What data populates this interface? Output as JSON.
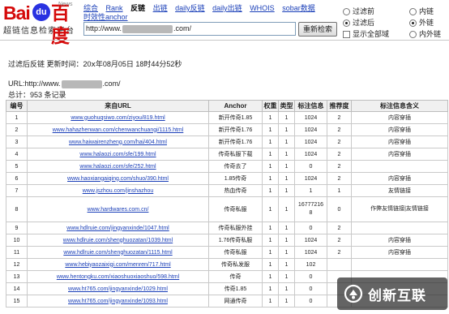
{
  "header": {
    "logo_left": "Bai",
    "logo_paw": "du",
    "logo_right": "百度",
    "logo_tag": "News",
    "logo_subtitle": "超链信息检索平台",
    "nav": [
      "综合",
      "Rank",
      "反链",
      "出链",
      "daily反链",
      "daily出链",
      "WHOIS",
      "sobar数据"
    ],
    "nav_active_index": 2,
    "nav_second": "时效性anchor",
    "url_prefix": "http://www.",
    "url_suffix": ".com/",
    "search_button": "重新检索",
    "option_left": [
      "过滤前",
      "过滤后",
      "显示全部域"
    ],
    "option_right": [
      "内链",
      "外链",
      "内外链"
    ]
  },
  "info": {
    "line1": "过滤后反链  更新时间：20ⅹ年08月05日  18时44分52秒",
    "url_label": "URL:http://www.",
    "url_suffix": ".com/",
    "total": "总计：953 条记录"
  },
  "table": {
    "headers": [
      "编号",
      "来自URL",
      "Anchor",
      "权重",
      "类型",
      "标注信息",
      "推荐度",
      "标注信息含义"
    ],
    "rows": [
      [
        "1",
        "www.guohuqsiwo.com/ziyou/819.html",
        "新开传奇1.85",
        "1",
        "1",
        "1024",
        "2",
        "内容穿插"
      ],
      [
        "2",
        "www.hahazhenwan.com/chenwanchuangi/1115.html",
        "新开传奇1.76",
        "1",
        "1",
        "1024",
        "2",
        "内容穿插"
      ],
      [
        "3",
        "www.haiwairenzheng.com/hai/404.html",
        "新开传奇1.76",
        "1",
        "1",
        "1024",
        "2",
        "内容穿插"
      ],
      [
        "4",
        "www.halaozi.com/sfe/199.html",
        "传奇私服下载",
        "1",
        "1",
        "1024",
        "2",
        "内容穿插"
      ],
      [
        "5",
        "www.halaozi.com/sfe/252.html",
        "传奇去了",
        "1",
        "1",
        "0",
        "2",
        ""
      ],
      [
        "6",
        "www.haoxiangaiqing.com/shuo/390.html",
        "1.85传奇",
        "1",
        "1",
        "1024",
        "2",
        "内容穿插"
      ],
      [
        "7",
        "www.jszhou.com/jinshazhou",
        "热血传奇",
        "1",
        "1",
        "1",
        "1",
        "友情链接"
      ],
      [
        "8",
        "www.hardwares.com.cn/",
        "传奇私服",
        "1",
        "1",
        "16777216\n8",
        "0",
        "作弊友情链接|友情链接"
      ],
      [
        "9",
        "www.hdlruie.com/jingyanxinde/1047.html",
        "传奇私服外挂",
        "1",
        "1",
        "0",
        "2",
        ""
      ],
      [
        "10",
        "www.hdlruie.com/shenghuozatan/1039.html",
        "1.76传奇私服",
        "1",
        "1",
        "1024",
        "2",
        "内容穿插"
      ],
      [
        "11",
        "www.hdlruie.com/shenghuozatan/1115.html",
        "传奇私服",
        "1",
        "1",
        "1024",
        "2",
        "内容穿插"
      ],
      [
        "12",
        "www.hebiyaozaixigi.com/menren/717.html",
        "传奇私发服",
        "1",
        "1",
        "102",
        "",
        ""
      ],
      [
        "13",
        "www.hentongku.com/xiaoshuoxiaoshuo/598.html",
        "传奇",
        "1",
        "1",
        "0",
        "",
        ""
      ],
      [
        "14",
        "www.ht765.com/jingyanxinde/1029.html",
        "传奇1.85",
        "1",
        "1",
        "0",
        "",
        ""
      ],
      [
        "15",
        "www.ht765.com/jingyanxinde/1093.html",
        "网通传奇",
        "1",
        "1",
        "0",
        "",
        ""
      ]
    ]
  },
  "watermark": {
    "text": "创新互联"
  }
}
